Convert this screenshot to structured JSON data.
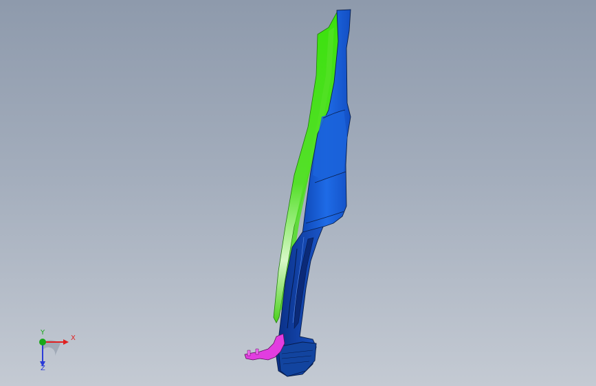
{
  "viewport": {
    "background_top": "#8e9aac",
    "background_bottom": "#c4cad3"
  },
  "model": {
    "colors": {
      "main_body": "#1a63dc",
      "main_body_shade": "#0f3f9e",
      "trim_panel": "#35d80f",
      "trim_panel_light": "#d6f7c4",
      "bracket": "#e23de0",
      "edge": "#0a1f4a"
    }
  },
  "triad": {
    "x_label": "X",
    "y_label": "Y",
    "z_label": "Z",
    "x_color": "#e02020",
    "y_color": "#18a818",
    "z_color": "#2b3bd8"
  }
}
